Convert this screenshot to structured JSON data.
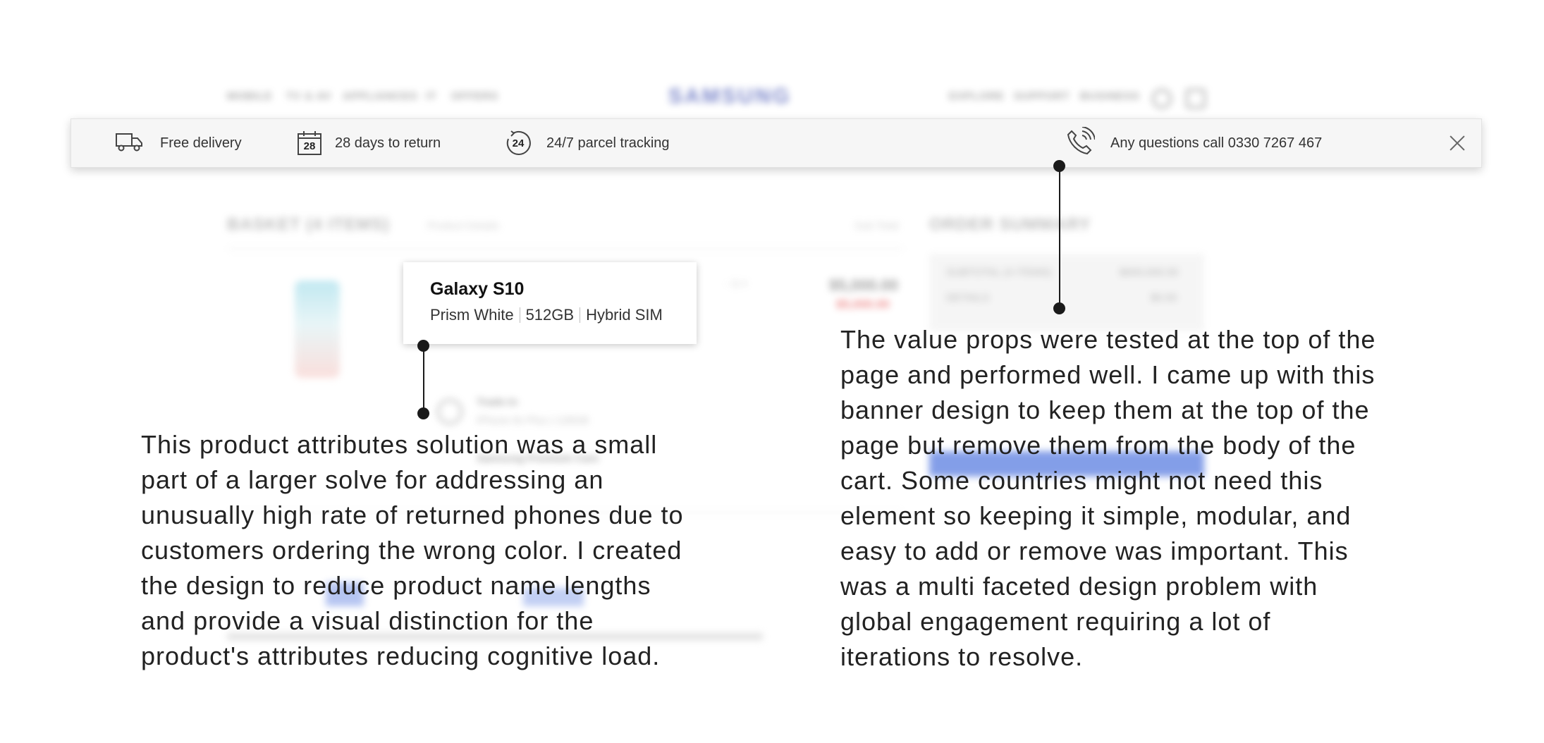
{
  "background_page": {
    "nav_left": [
      "MOBILE",
      "TV & AV",
      "APPLIANCES",
      "IT",
      "OFFERS"
    ],
    "logo": "SAMSUNG",
    "nav_right": [
      "EXPLORE",
      "SUPPORT",
      "BUSINESS"
    ],
    "basket_heading": "BASKET (4 ITEMS)",
    "product_details_label": "Product Details",
    "sub_total_label": "Sub Total",
    "order_summary_heading": "ORDER SUMMARY",
    "item_price": "$5,000.00",
    "item_old_price": "$5,000.00",
    "summary_label": "SUBTOTAL (4 ITEMS)",
    "summary_value": "$000,000.00",
    "delivery_label": "DETAILS",
    "delivery_value": "$0.00",
    "trade_in_label": "Trade-in",
    "trade_in_sub": "iPhone 6s Plus | 128GB",
    "care_label": "Samsung Premium Care"
  },
  "banner": {
    "items": [
      {
        "icon": "delivery-truck-icon",
        "label": "Free delivery"
      },
      {
        "icon": "calendar-icon",
        "icon_text": "28",
        "label": "28 days to return"
      },
      {
        "icon": "clock-24-icon",
        "icon_text": "24",
        "label": "24/7 parcel tracking"
      }
    ],
    "contact": {
      "icon": "phone-icon",
      "label": "Any questions call 0330 7267 467"
    },
    "close_icon": "close-icon"
  },
  "product_card": {
    "title": "Galaxy S10",
    "attributes": [
      "Prism White",
      "512GB",
      "Hybrid SIM"
    ]
  },
  "annotations": {
    "left": "This product attributes solution was a small\npart of a larger solve for addressing an\nunusually high rate of returned phones due to\ncustomers ordering the wrong color. I created\nthe design to reduce product name lengths\nand provide a visual distinction for the\nproduct's attributes reducing cognitive load.",
    "right": "The value props were tested at the top of the\npage and performed well. I came up with this\nbanner design to keep them at the top of the\npage but remove them from the body of the\ncart. Some countries might not need this\nelement so keeping it simple, modular, and\neasy to add or remove was important. This\nwas a multi faceted design problem with\nglobal engagement requiring a lot of\niterations to resolve."
  },
  "colors": {
    "brand": "#1428a0",
    "price_sale": "#e0302f",
    "dot": "#1a1a1a"
  }
}
